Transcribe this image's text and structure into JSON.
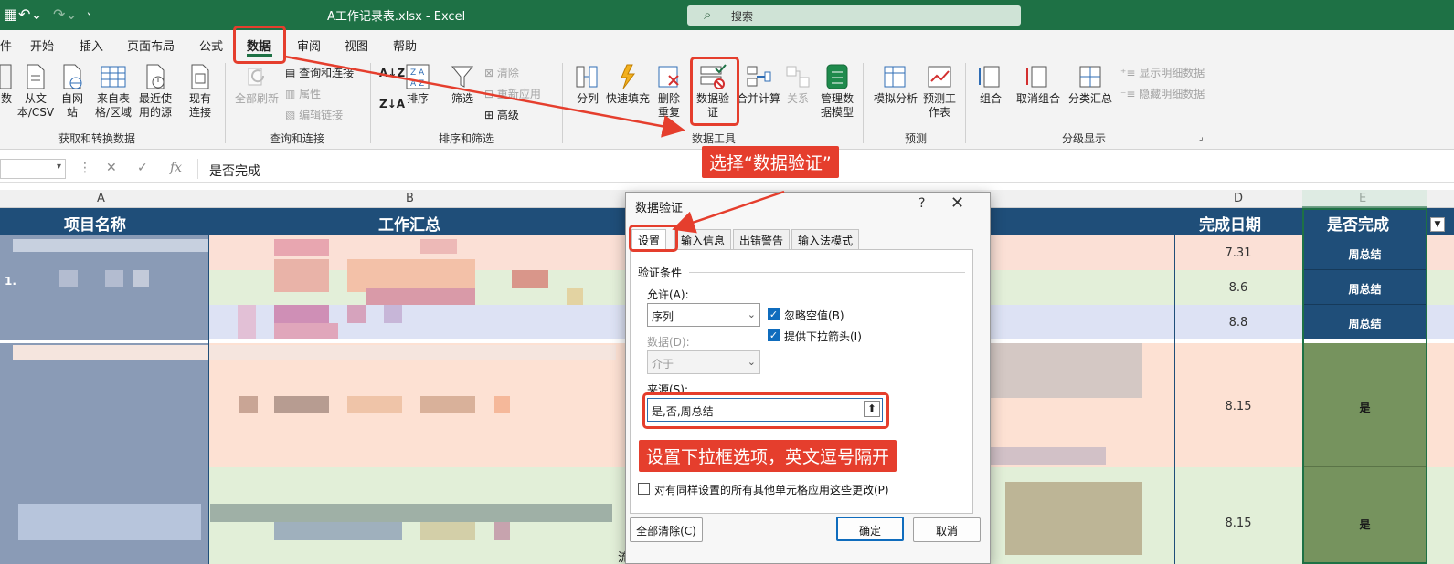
{
  "titlebar": {
    "doc_title": "A工作记录表.xlsx  -  Excel",
    "search_placeholder": "搜索"
  },
  "tabs": [
    "件",
    "开始",
    "插入",
    "页面布局",
    "公式",
    "数据",
    "审阅",
    "视图",
    "帮助"
  ],
  "active_tab": "数据",
  "ribbon": {
    "get_transform": {
      "buttons": [
        "数",
        "从文本/CSV",
        "自网站",
        "来自表格/区域",
        "最近使用的源",
        "现有连接"
      ],
      "label": "获取和转换数据"
    },
    "queries": {
      "refresh_all": "全部刷新",
      "items": [
        "查询和连接",
        "属性",
        "编辑链接"
      ],
      "label": "查询和连接"
    },
    "sort_filter": {
      "sort": "排序",
      "filter": "筛选",
      "items": [
        "清除",
        "重新应用",
        "高级"
      ],
      "label": "排序和筛选"
    },
    "data_tools": {
      "buttons": [
        "分列",
        "快速填充",
        "删除重复值",
        "数据验证",
        "合并计算",
        "关系",
        "管理数据模型"
      ],
      "label": "数据工具"
    },
    "forecast": {
      "buttons": [
        "模拟分析",
        "预测工作表"
      ],
      "label": "预测"
    },
    "outline": {
      "buttons": [
        "组合",
        "取消组合",
        "分类汇总"
      ],
      "items": [
        "显示明细数据",
        "隐藏明细数据"
      ],
      "label": "分级显示"
    }
  },
  "formula_bar": {
    "content": "是否完成"
  },
  "columns": [
    "A",
    "B",
    "D",
    "E"
  ],
  "grid": {
    "headers": [
      "项目名称",
      "工作汇总",
      "完成日期",
      "是否完成"
    ],
    "row_number_fragment": "1.",
    "side_fragments": [
      "流程："
    ],
    "rows": [
      {
        "date": "7.31",
        "status": "周总结"
      },
      {
        "date": "8.6",
        "status": "周总结"
      },
      {
        "date": "8.8",
        "status": "周总结"
      },
      {
        "date": "8.15",
        "status": "是"
      },
      {
        "date": "8.15",
        "status": "是"
      }
    ]
  },
  "dialog": {
    "title": "数据验证",
    "help": "?",
    "close": "✕",
    "tabs": [
      "设置",
      "输入信息",
      "出错警告",
      "输入法模式"
    ],
    "section": "验证条件",
    "allow_label": "允许(A):",
    "allow_value": "序列",
    "ignore_blank": "忽略空值(B)",
    "dropdown_arrow": "提供下拉箭头(I)",
    "data_label": "数据(D):",
    "data_value": "介于",
    "source_label": "来源(S):",
    "source_value": "是,否,周总结",
    "apply_all": "对有同样设置的所有其他单元格应用这些更改(P)",
    "clear_all": "全部清除(C)",
    "ok": "确定",
    "cancel": "取消"
  },
  "annotations": {
    "callout_1": "选择“数据验证”",
    "callout_2": "设置下拉框选项，英文逗号隔开"
  },
  "colors": {
    "excel_green": "#1e7145",
    "header_blue": "#1f4e79",
    "annotation_red": "#e53e2d",
    "status_green": "#76935e"
  }
}
